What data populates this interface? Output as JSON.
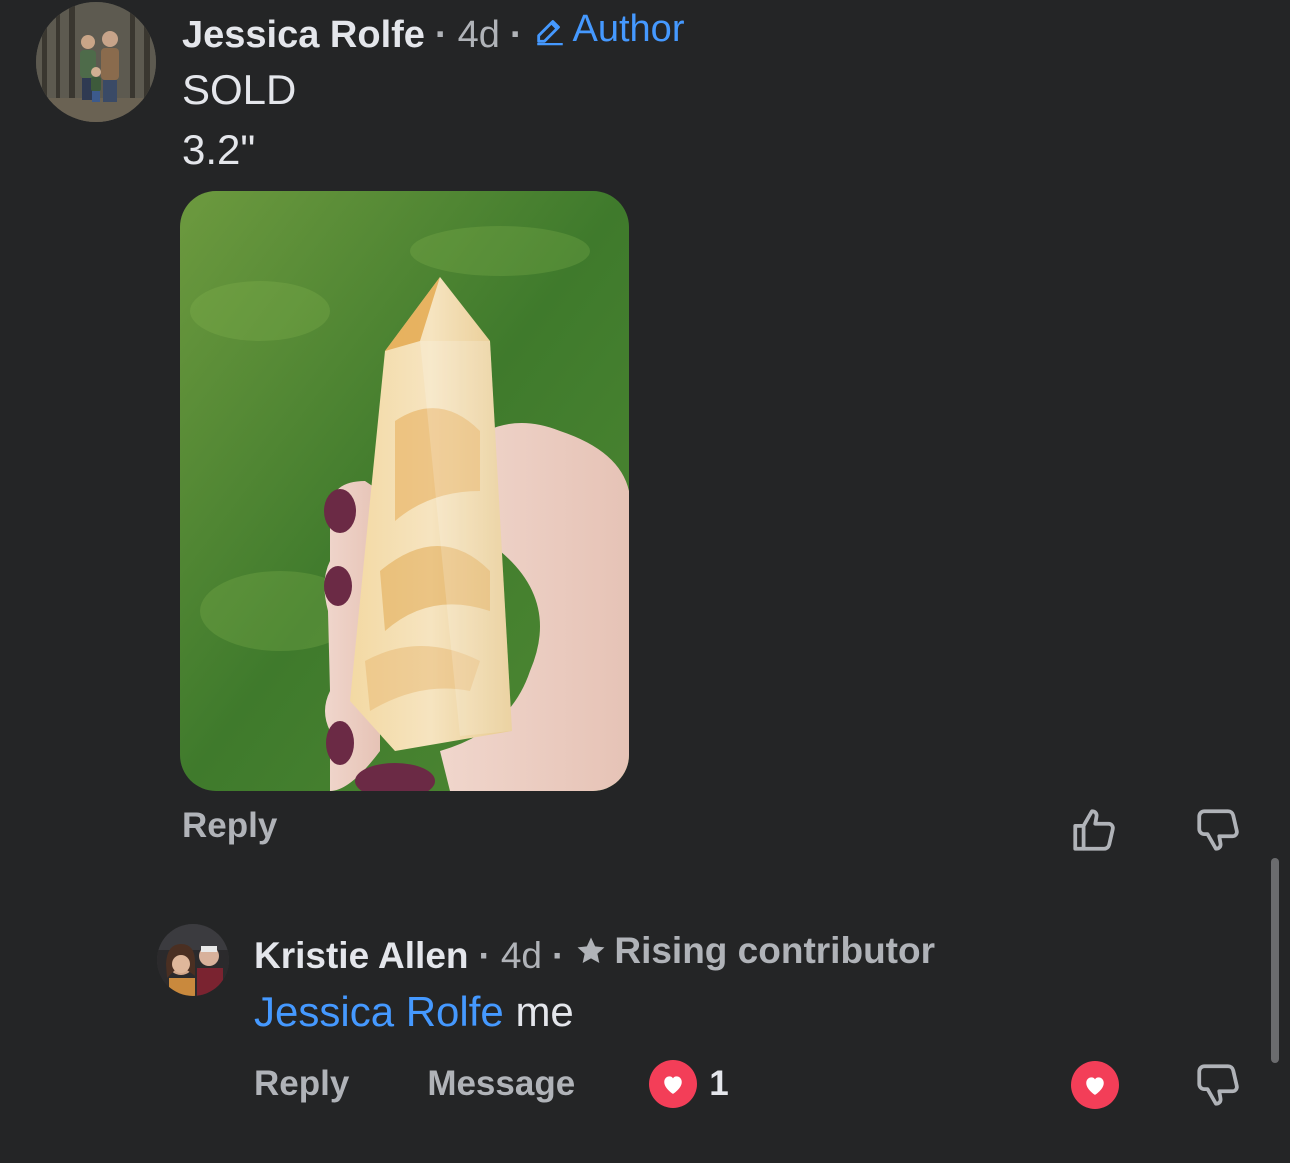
{
  "comment": {
    "author": "Jessica Rolfe",
    "time": "4d",
    "separator": "·",
    "badge": "Author",
    "lines": [
      "SOLD",
      "3.2\""
    ],
    "reply_label": "Reply"
  },
  "reply": {
    "author": "Kristie Allen",
    "time": "4d",
    "separator": "·",
    "badge": "Rising contributor",
    "mention": "Jessica Rolfe",
    "text": "me",
    "reply_label": "Reply",
    "message_label": "Message",
    "reaction_count": "1"
  },
  "icons": {
    "edit": "pencil-icon",
    "star": "star-icon",
    "like": "thumbs-up-icon",
    "dislike": "thumbs-down-icon",
    "love": "heart-icon"
  },
  "colors": {
    "background": "#242526",
    "text": "#e4e6eb",
    "muted": "#b0b3b8",
    "accent_blue": "#4599ff",
    "heart_red": "#f33e58"
  }
}
